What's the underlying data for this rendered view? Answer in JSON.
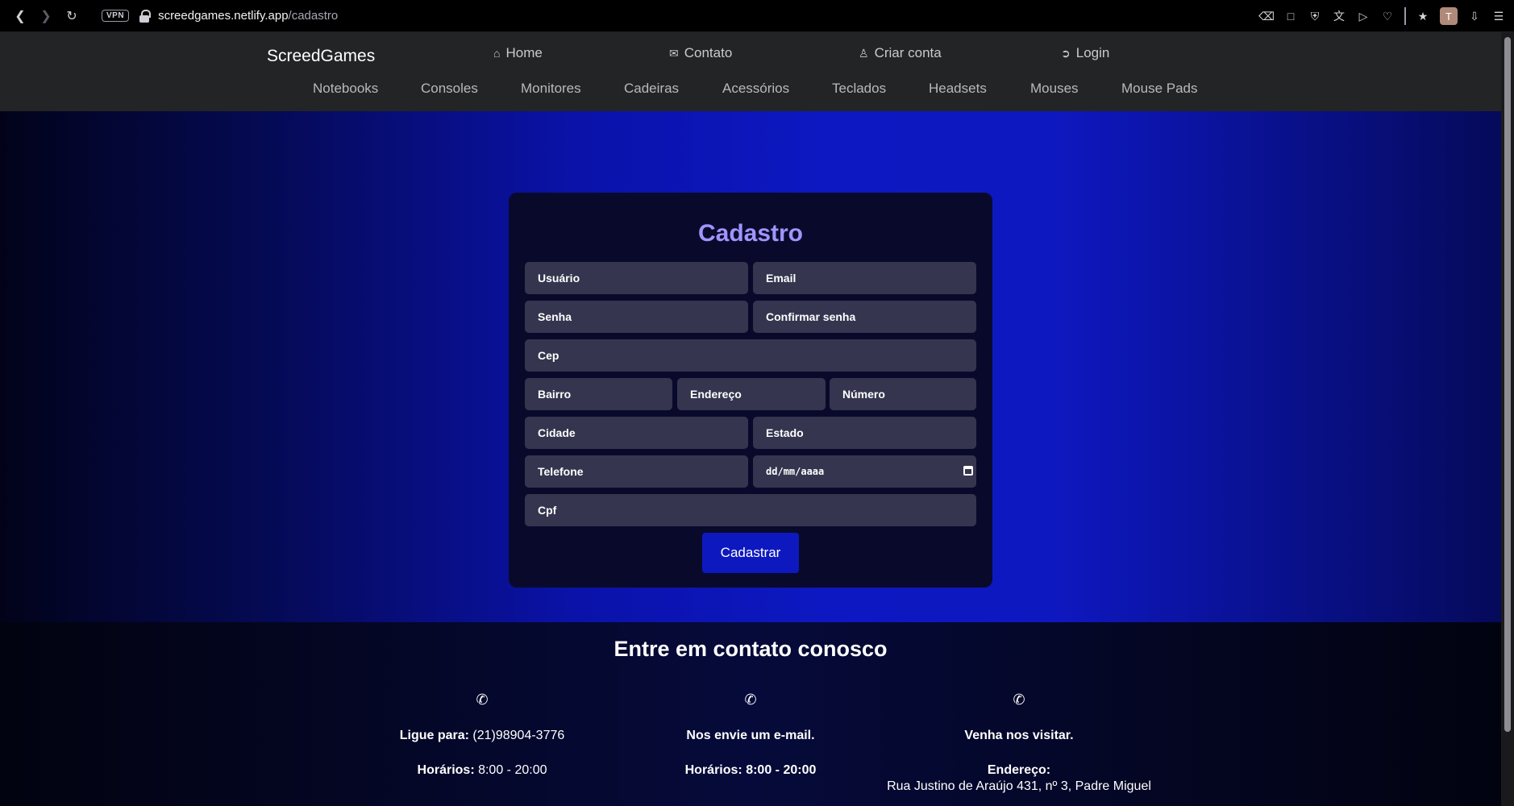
{
  "browser": {
    "vpn_label": "VPN",
    "url_domain": "screedgames.netlify.app",
    "url_path": "/cadastro",
    "profile_initial": "T"
  },
  "header": {
    "brand": "ScreedGames",
    "top_links": [
      {
        "label": "Home",
        "icon": "home-icon"
      },
      {
        "label": "Contato",
        "icon": "mail-icon"
      },
      {
        "label": "Criar conta",
        "icon": "person-icon"
      },
      {
        "label": "Login",
        "icon": "login-icon"
      }
    ],
    "categories": [
      "Notebooks",
      "Consoles",
      "Monitores",
      "Cadeiras",
      "Acessórios",
      "Teclados",
      "Headsets",
      "Mouses",
      "Mouse Pads"
    ]
  },
  "form": {
    "title": "Cadastro",
    "fields": {
      "usuario": "Usuário",
      "email": "Email",
      "senha": "Senha",
      "confirmar_senha": "Confirmar senha",
      "cep": "Cep",
      "bairro": "Bairro",
      "endereco": "Endereço",
      "numero": "Número",
      "cidade": "Cidade",
      "estado": "Estado",
      "telefone": "Telefone",
      "data_nascimento": "dd/mm/aaaa",
      "cpf": "Cpf"
    },
    "submit_label": "Cadastrar"
  },
  "footer": {
    "title": "Entre em contato conosco",
    "columns": [
      {
        "heading_bold": "Ligue para:",
        "heading_rest": " (21)98904-3776",
        "hours_bold": "Horários:",
        "hours_rest": " 8:00 - 20:00"
      },
      {
        "heading_bold": "Nos envie um e-mail.",
        "heading_rest": "",
        "hours_bold": "Horários: 8:00 - 20:00",
        "hours_rest": ""
      },
      {
        "heading_bold": "Venha nos visitar.",
        "heading_rest": "",
        "hours_bold": "Endereço:",
        "address": "Rua Justino de Araújo 431, nº 3, Padre Miguel"
      }
    ]
  },
  "colors": {
    "accent": "#0d19bf",
    "title": "#a094ff",
    "field_bg": "#35354f",
    "card_bg": "#090a2b"
  }
}
